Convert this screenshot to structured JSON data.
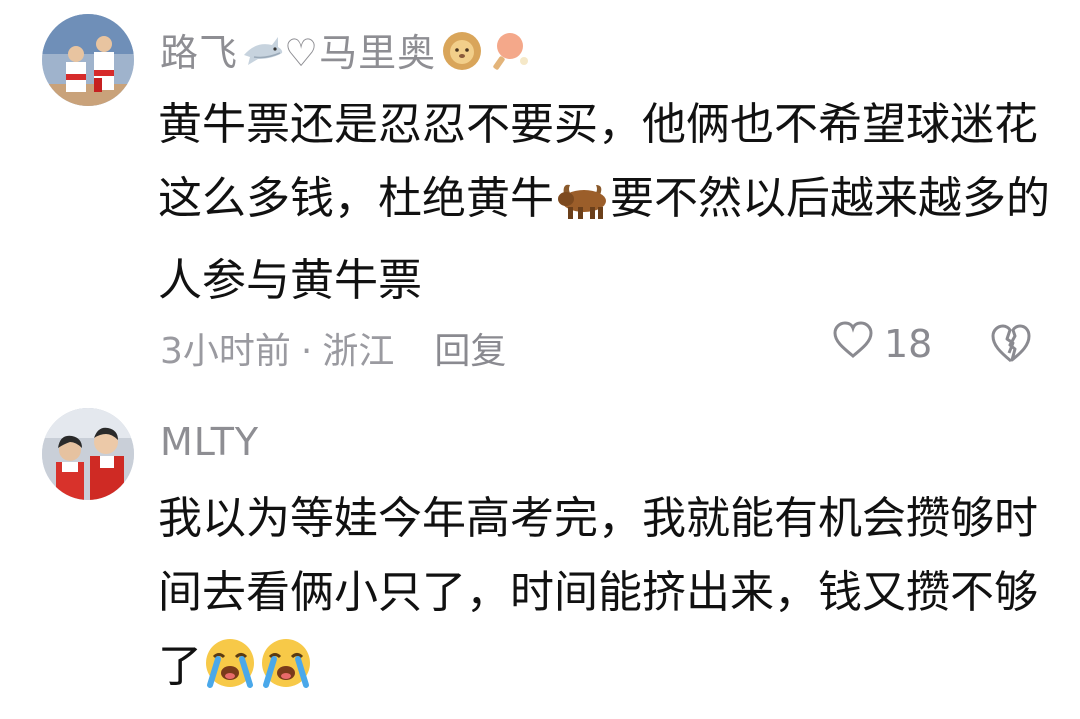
{
  "comments": [
    {
      "username": "路飞",
      "username_suffix": "♡马里奥",
      "username_emojis": [
        "shark-emoji",
        "lion-emoji",
        "ping-pong-emoji"
      ],
      "text_parts": [
        "黄牛票还是忍忍不要买，他俩也不希望球迷花这么多钱，杜绝黄牛",
        "要不然以后越来越多的人参与黄牛票"
      ],
      "inline_emoji": "ox-emoji",
      "time": "3小时前",
      "separator": "·",
      "location": "浙江",
      "reply_label": "回复",
      "like_count": "18"
    },
    {
      "username": "MLTY",
      "text": "我以为等娃今年高考完，我就能有机会攒够时间去看俩小只了，时间能挤出来，钱又攒不够了",
      "trailing_emojis": [
        "loudly-crying-face-emoji",
        "loudly-crying-face-emoji"
      ]
    }
  ],
  "colors": {
    "username": "#8e8e93",
    "body": "#111111",
    "meta": "#9a9aa0",
    "background": "#ffffff"
  }
}
